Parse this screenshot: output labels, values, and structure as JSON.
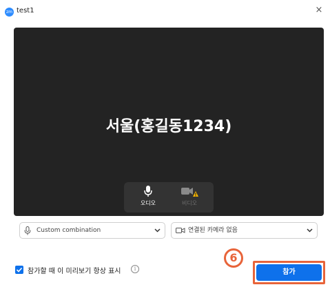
{
  "window": {
    "logo_text": "zm",
    "title": "test1",
    "close_glyph": "×"
  },
  "preview": {
    "display_name": "서울(홍길동1234)",
    "audio_label": "오디오",
    "video_label": "비디오"
  },
  "devices": {
    "microphone": "Custom combination",
    "camera": "연결된 카메라 없음"
  },
  "footer": {
    "always_show_preview_checked": true,
    "always_show_preview_label": "참가할 때 이 미리보기 항상 표시",
    "info_glyph": "i",
    "step_marker": "6",
    "join_label": "참가"
  },
  "colors": {
    "accent_blue": "#0e71eb",
    "highlight_orange": "#e8643a",
    "preview_bg": "#232323",
    "warning_yellow": "#f5b400"
  }
}
